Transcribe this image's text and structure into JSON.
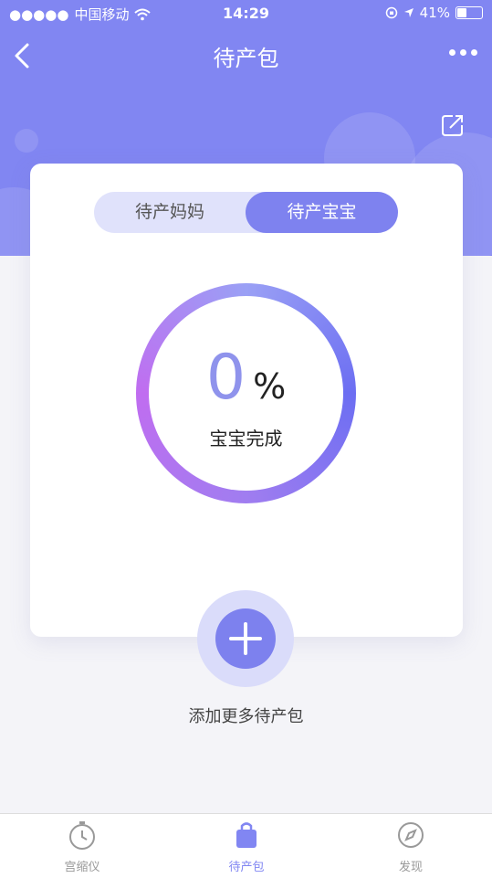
{
  "status_bar": {
    "signal": "●●●●●",
    "carrier": "中国移动",
    "time": "14:29",
    "battery_percent": "41%",
    "battery_level": 0.41
  },
  "nav": {
    "title": "待产包"
  },
  "tabs": [
    {
      "label": "待产妈妈",
      "active": false
    },
    {
      "label": "待产宝宝",
      "active": true
    }
  ],
  "progress": {
    "value": "0",
    "unit": "%",
    "label": "宝宝完成",
    "level": 0
  },
  "add": {
    "label": "添加更多待产包"
  },
  "tabbar": {
    "items": [
      {
        "label": "宫缩仪",
        "icon": "stopwatch-icon"
      },
      {
        "label": "待产包",
        "icon": "bag-icon",
        "active": true
      },
      {
        "label": "发现",
        "icon": "compass-icon"
      }
    ]
  },
  "colors": {
    "accent": "#8186f2",
    "accent_dark": "#7e82ef",
    "tab_bg": "#e0e2fb"
  }
}
